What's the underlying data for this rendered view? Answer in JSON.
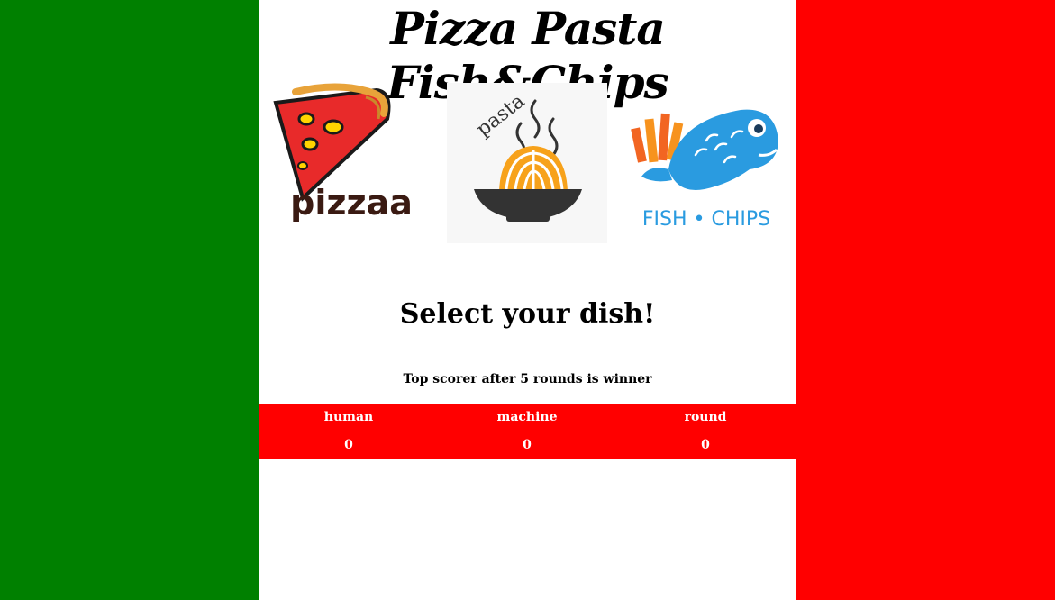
{
  "header": {
    "title": "Pizza Pasta Fish&Chips"
  },
  "dishes": [
    {
      "id": "pizza",
      "label": "pizzaa"
    },
    {
      "id": "pasta",
      "label": "pasta"
    },
    {
      "id": "fish",
      "label": "FISH • CHIPS"
    }
  ],
  "prompt": "Select your dish!",
  "rules": "Top scorer after 5 rounds is winner",
  "scoreboard": {
    "human_label": "human",
    "machine_label": "machine",
    "round_label": "round",
    "human_score": "0",
    "machine_score": "0",
    "round": "0"
  },
  "colors": {
    "flag_green": "#008000",
    "flag_white": "#ffffff",
    "flag_red": "#ff0000",
    "fish_blue": "#2a9be0",
    "chips_orange": "#f26522"
  }
}
